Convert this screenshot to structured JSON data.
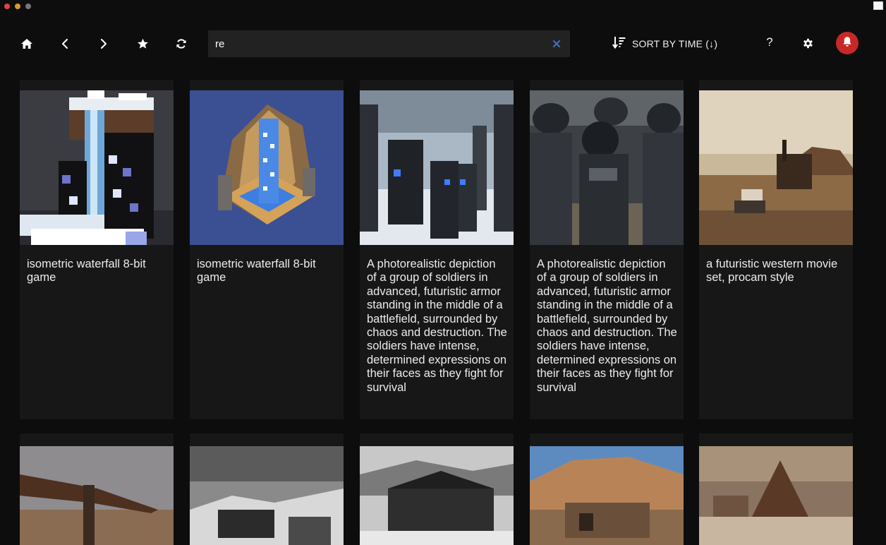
{
  "window": {
    "colors": {
      "close": "#e0443e",
      "minimize": "#d99a2b",
      "maximize": "#777777"
    }
  },
  "toolbar": {
    "icons": [
      "home-icon",
      "chevron-left-icon",
      "chevron-right-icon",
      "star-icon",
      "refresh-icon"
    ],
    "search": {
      "value": "re",
      "placeholder": ""
    },
    "sort_label": "SORT BY TIME (↓)",
    "help_label": "?",
    "accent": "#c62828"
  },
  "gallery": {
    "rows": [
      [
        {
          "caption": "isometric waterfall 8-bit game",
          "image": "pixel-waterfall-snow"
        },
        {
          "caption": "isometric waterfall 8-bit game",
          "image": "pixel-waterfall-blue"
        },
        {
          "caption": "A photorealistic depiction of a group of soldiers in advanced, futuristic armor standing in the middle of a battlefield, surrounded by chaos and destruction. The soldiers have intense, determined expressions on their faces as they fight for survival",
          "image": "armored-soldiers-snow"
        },
        {
          "caption": "A photorealistic depiction of a group of soldiers in advanced, futuristic armor standing in the middle of a battlefield, surrounded by chaos and destruction. The soldiers have intense, determined expressions on their faces as they fight for survival",
          "image": "armored-soldiers-close"
        },
        {
          "caption": "a futuristic western movie set, procam style",
          "image": "western-desert-set"
        }
      ],
      [
        {
          "caption": "",
          "image": "western-roof-structure"
        },
        {
          "caption": "",
          "image": "grayscale-rocky-town"
        },
        {
          "caption": "",
          "image": "bw-western-buildings"
        },
        {
          "caption": "",
          "image": "canyon-cabin"
        },
        {
          "caption": "",
          "image": "sepia-western-town"
        }
      ]
    ]
  }
}
